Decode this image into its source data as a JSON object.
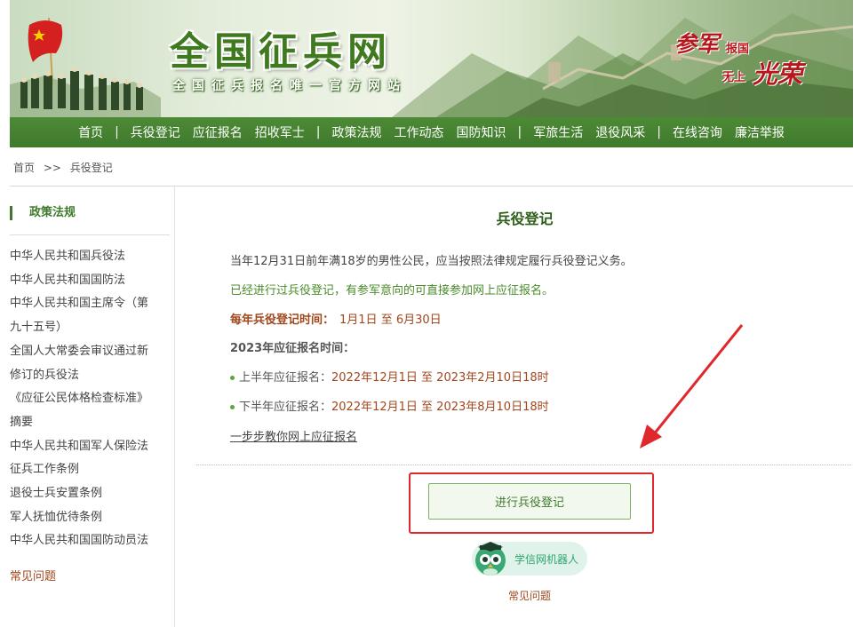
{
  "header": {
    "title": "全国征兵网",
    "subtitle": "全国征兵报名唯一官方网站",
    "slogan": {
      "part1": "参军",
      "part2": "报国",
      "part3": "无上",
      "part4": "光荣"
    },
    "brand_color": "#3f7a2c",
    "accent_color": "#b8161b"
  },
  "nav": {
    "items": [
      "首页",
      "兵役登记",
      "应征报名",
      "招收军士",
      "政策法规",
      "工作动态",
      "国防知识",
      "军旅生活",
      "退役风采",
      "在线咨询",
      "廉洁举报"
    ],
    "separator": "|"
  },
  "breadcrumb": {
    "home": "首页",
    "sep": ">>",
    "current": "兵役登记"
  },
  "sidebar": {
    "title": "政策法规",
    "items": [
      "中华人民共和国兵役法",
      "中华人民共和国国防法",
      "中华人民共和国主席令（第",
      "九十五号）",
      "全国人大常委会审议通过新",
      "修订的兵役法",
      "《应征公民体格检查标准》",
      "摘要",
      "中华人民共和国军人保险法",
      "征兵工作条例",
      "退役士兵安置条例",
      "军人抚恤优待条例",
      "中华人民共和国国防动员法"
    ],
    "faq": "常见问题"
  },
  "main": {
    "title": "兵役登记",
    "line1": "当年12月31日前年满18岁的男性公民，应当按照法律规定履行兵役登记义务。",
    "line2": "已经进行过兵役登记，有参军意向的可直接参加网上应征报名。",
    "reg_time_label": "每年兵役登记时间：",
    "reg_time_value": "1月1日 至 6月30日",
    "apply_title": "2023年应征报名时间：",
    "first_half_label": "上半年应征报名：",
    "first_half_value": "2022年12月1日 至 2023年2月10日18时",
    "second_half_label": "下半年应征报名：",
    "second_half_value": "2022年12月1日 至 2023年8月10日18时",
    "tutorial_link": "一步步教你网上应征报名",
    "register_button": "进行兵役登记",
    "robot_label": "学信网机器人",
    "faq": "常见问题"
  }
}
